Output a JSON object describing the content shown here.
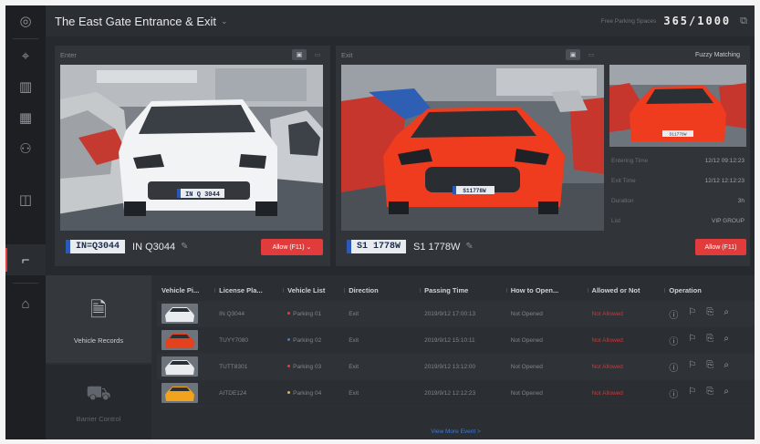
{
  "header": {
    "title": "The East Gate Entrance & Exit",
    "title_caret": "⌄",
    "free_label": "Free Parking Spaces",
    "free_value": "365/1000",
    "popout_icon": "⧉"
  },
  "rail": {
    "items": [
      {
        "icon": "◎",
        "name": "globe-icon"
      },
      {
        "icon": "⌖",
        "name": "face-scan-icon"
      },
      {
        "icon": "▥",
        "name": "layout-icon"
      },
      {
        "icon": "▦",
        "name": "grid-icon"
      },
      {
        "icon": "⚇",
        "name": "person-icon"
      },
      {
        "icon": "◫",
        "name": "door-icon"
      },
      {
        "icon": "⌐",
        "name": "barrier-icon"
      },
      {
        "icon": "⌂",
        "name": "alarm-icon"
      }
    ]
  },
  "enter": {
    "label": "Enter",
    "plate_image_text": "IN=Q3044",
    "plate_photo_text": "IN Q 3044",
    "plate_text": "IN Q3044",
    "edit_icon": "✎",
    "allow_button": "Allow (F11)  ⌄",
    "snapshot_icon": "▣",
    "video_icon": "▭"
  },
  "exit": {
    "label": "Exit",
    "plate_image_text": "S1 1778W",
    "plate_photo_text": "S11778W",
    "plate_text": "S1 1778W",
    "edit_icon": "✎",
    "allow_button": "Allow (F11)",
    "snapshot_icon": "▣",
    "video_icon": "▭",
    "fuzzy_label": "Fuzzy Matching",
    "thumb_plate_text": "S11778W",
    "info": [
      {
        "key": "Entering Time",
        "value": "12/12 09:12:23"
      },
      {
        "key": "Exit Time",
        "value": "12/12 12:12:23"
      },
      {
        "key": "Duration",
        "value": "3h"
      },
      {
        "key": "List",
        "value": "VIP GROUP"
      }
    ]
  },
  "records": {
    "tabs": [
      {
        "label": "Vehicle Records",
        "icon": "🗎"
      },
      {
        "label": "Barrier Control",
        "icon": "⛟"
      }
    ],
    "columns": [
      "Vehicle Pi...",
      "License Pla...",
      "Vehicle List",
      "Direction",
      "Passing Time",
      "How to Open...",
      "Allowed or Not",
      "Operation"
    ],
    "rows": [
      {
        "plate": "IN Q3044",
        "list": "Parking 01",
        "list_color": "#d0473f",
        "direction": "Exit",
        "time": "2019/9/12 17:00:13",
        "open": "Not Opened",
        "allowed": "Not Allowed",
        "car": "#e9ecef"
      },
      {
        "plate": "TUYY7080",
        "list": "Parking 02",
        "list_color": "#3a7bd5",
        "direction": "Exit",
        "time": "2019/9/12 15:10:11",
        "open": "Not Opened",
        "allowed": "Not Allowed",
        "car": "#e4411f"
      },
      {
        "plate": "TUTT8301",
        "list": "Parking 03",
        "list_color": "#d0473f",
        "direction": "Exit",
        "time": "2019/9/12 13:12:00",
        "open": "Not Opened",
        "allowed": "Not Allowed",
        "car": "#e9ecef"
      },
      {
        "plate": "AITDE124",
        "list": "Parking 04",
        "list_color": "#e0b62f",
        "direction": "Exit",
        "time": "2019/9/12 12:12:23",
        "open": "Not Opened",
        "allowed": "Not Allowed",
        "car": "#f1a31d"
      }
    ],
    "op_icons": [
      "ⓘ",
      "⚐",
      "⎘",
      "⌕"
    ],
    "view_more": "View More Event >"
  }
}
